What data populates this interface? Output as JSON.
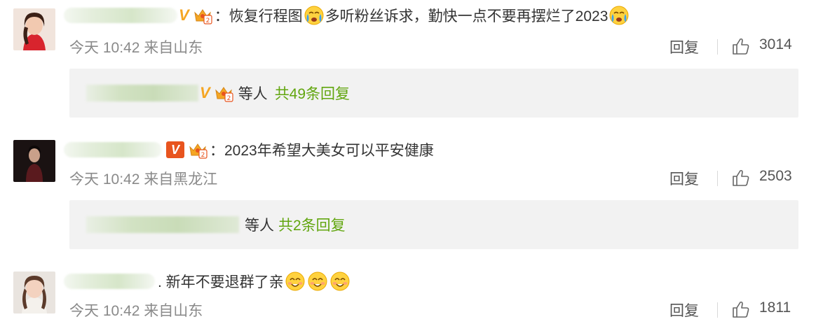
{
  "comments": [
    {
      "text": "：恢复行程图",
      "text2": "多听粉丝诉求，勤快一点不要再摆烂了2023",
      "time": "今天 10:42",
      "source": "来自山东",
      "reply_label": "回复",
      "likes": "3014",
      "sub": {
        "suffix": "等人",
        "count_text": "共49条回复"
      }
    },
    {
      "text": "：2023年希望大美女可以平安健康",
      "time": "今天 10:42",
      "source": "来自黑龙江",
      "reply_label": "回复",
      "likes": "2503",
      "sub": {
        "suffix": "等人",
        "count_text": "共2条回复"
      }
    },
    {
      "text": ". 新年不要退群了亲",
      "time": "今天 10:42",
      "source": "来自山东",
      "reply_label": "回复",
      "likes": "1811"
    }
  ],
  "icons": {
    "like": "thumbs-up-icon",
    "emoji_crying": "crying-face-emoji",
    "emoji_smile": "smiling-face-emoji",
    "vip": "vip-v-badge",
    "fan_badge": "crown-fan-badge"
  },
  "colors": {
    "meta": "#8a8a8a",
    "link_green": "#62a60f",
    "sub_bg": "#f2f2f2",
    "vip_orange": "#f5a623",
    "vip_red": "#e8541e"
  }
}
